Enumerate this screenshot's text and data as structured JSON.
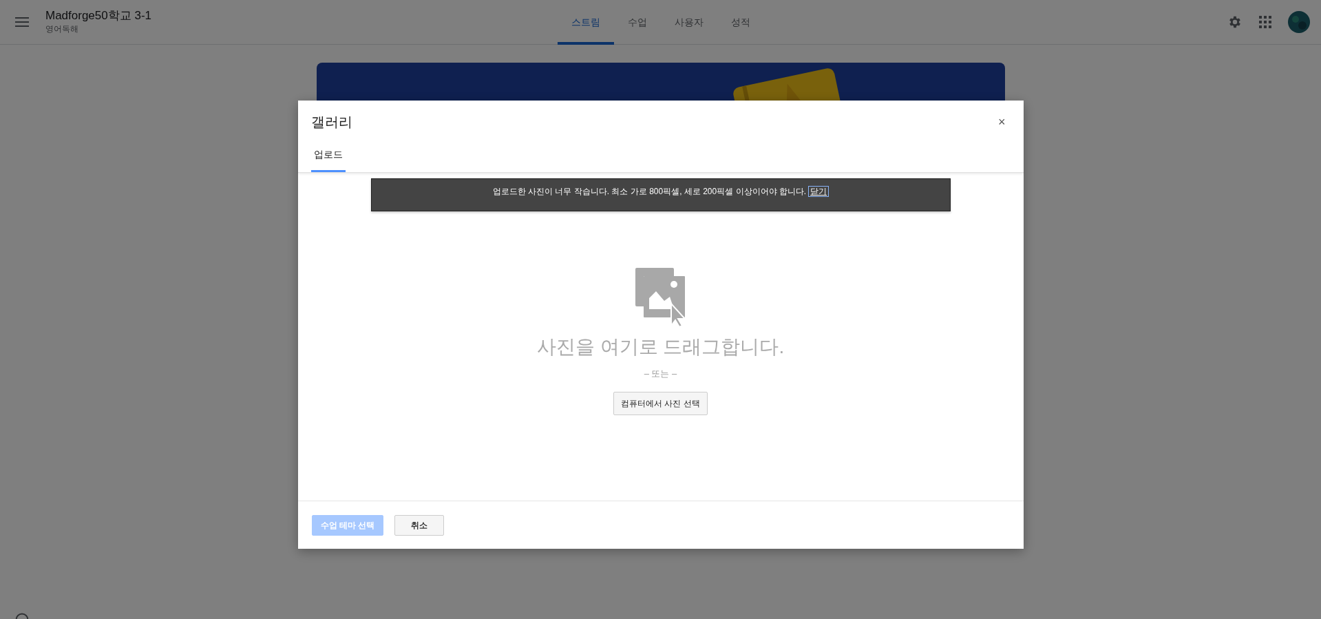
{
  "app_bar": {
    "class_name": "Madforge50학교 3-1",
    "subject": "영어독해",
    "tabs": [
      {
        "label": "스트림",
        "selected": true
      },
      {
        "label": "수업",
        "selected": false
      },
      {
        "label": "사용자",
        "selected": false
      },
      {
        "label": "성적",
        "selected": false
      }
    ]
  },
  "dialog": {
    "title": "갤러리",
    "close": "×",
    "tabs": [
      {
        "label": "업로드",
        "selected": true
      }
    ],
    "notice": {
      "message": "업로드한 사진이 너무 작습니다. 최소 가로 800픽셀, 세로 200픽셀 이상이어야 합니다.",
      "link": "닫기"
    },
    "drop_zone": {
      "prompt": "사진을 여기로 드래그합니다.",
      "separator": "– 또는 –",
      "button": "컴퓨터에서 사진 선택"
    },
    "buttons": [
      {
        "label": "수업 테마 선택",
        "kind": "primary",
        "disabled": true
      },
      {
        "label": "취소",
        "kind": "secondary",
        "disabled": false
      }
    ]
  }
}
